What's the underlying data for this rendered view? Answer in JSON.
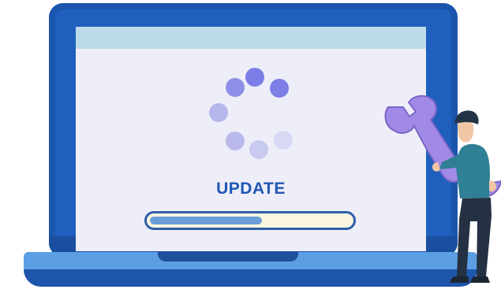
{
  "screen": {
    "status_label": "UPDATE",
    "progress": 0.56
  },
  "colors": {
    "laptop_frame": "#1f5fbe",
    "screen_background": "#eeeef9",
    "screen_topbar": "#bcdbea",
    "spinner": "#7d7ee8",
    "label": "#1f58b4",
    "progress_fill": "#6b9dd8",
    "progress_track": "#fbf6df",
    "laptop_base": "#5c9ee3"
  },
  "icons": {
    "spinner": "loading-spinner-icon",
    "technician": "technician-with-wrench",
    "wrench": "wrench-icon"
  }
}
